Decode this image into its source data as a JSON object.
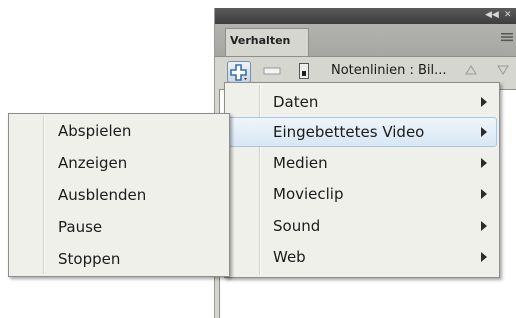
{
  "panel": {
    "tab_label": "Verhalten",
    "topbar_buttons": [
      "◀◀",
      "✕"
    ]
  },
  "toolbar": {
    "add_icon": "plus-icon",
    "remove_icon": "minus-icon",
    "notes_label": "Notenlinien : Bil...",
    "up_icon": "triangle-up-icon",
    "down_icon": "triangle-down-icon"
  },
  "main_menu": {
    "items": [
      {
        "label": "Daten",
        "has_submenu": true
      },
      {
        "label": "Eingebettetes Video",
        "has_submenu": true,
        "highlighted": true
      },
      {
        "label": "Medien",
        "has_submenu": true
      },
      {
        "label": "Movieclip",
        "has_submenu": true
      },
      {
        "label": "Sound",
        "has_submenu": true
      },
      {
        "label": "Web",
        "has_submenu": true
      }
    ]
  },
  "submenu": {
    "items": [
      {
        "label": "Abspielen"
      },
      {
        "label": "Anzeigen"
      },
      {
        "label": "Ausblenden"
      },
      {
        "label": "Pause"
      },
      {
        "label": "Stoppen"
      }
    ]
  },
  "colors": {
    "panel_bg": "#d6d6d0",
    "menu_bg": "#f0f0eb",
    "highlight_border": "#a8c6e6",
    "add_button_blue": "#3a6fb0"
  }
}
